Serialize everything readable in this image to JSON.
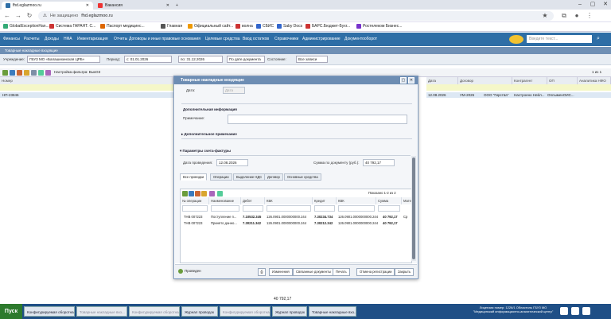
{
  "browser": {
    "tabs": [
      {
        "label": "fhd.eglazmoo.ru",
        "active": true
      },
      {
        "label": "Вакансия",
        "active": false
      }
    ],
    "url_security": "Не защищено",
    "url": "fhd.eglazmoo.ru",
    "bookmarks": [
      "GlobalExceptionHan...",
      "Система ГАРАНТ. С...",
      "Паспорт медицинс...",
      "Главная",
      "Официальный сайт...",
      "волна",
      "СБИС",
      "Saby Docs",
      "БАРС.Бюджет-Бухг...",
      "Ростелеком Бизнес..."
    ]
  },
  "app": {
    "menu": [
      "Финансы",
      "Расчеты",
      "Доходы",
      "НФА",
      "Инвентаризация",
      "Отчеты",
      "Договоры и иные правовые основания",
      "Целевые средства",
      "Ввод остатков",
      "Справочники",
      "Администрирование",
      "Документооборот"
    ],
    "search_placeholder": "Введите текст...",
    "doc_strip": "Товарные накладные входящие",
    "filter": {
      "institution_label": "Учреждение:",
      "institution_value": "ГБУЗ МО «Балашихинская ЦРБ»",
      "period_label": "Период:",
      "period_from": "с: 01.01.2026",
      "period_to": "по: 31.12.2026",
      "period_type": "По дате документа",
      "state_label": "Состояние:",
      "state_value": "Все записи"
    },
    "toolbar_filter_label": "Настройка фильтра: ВыкОЗ",
    "pager": "1 из 1",
    "grid_left_header": "Номер",
    "grid_left_row": "НП-23846",
    "grid_right_headers": [
      "Дата",
      "Договор",
      "Контрагент",
      "ОП",
      "Аналитика НФО"
    ],
    "grid_right_row": [
      "12.08.2026",
      "УМ-2026",
      "ООО \"Гирства\"",
      "Настроено Нейл...",
      "ОплыменОИС..."
    ]
  },
  "modal": {
    "title": "Товарные накладные входящие",
    "date_label": "Дата:",
    "date_value": "Дата",
    "additional_info_header": "Дополнительная информация",
    "note_label": "Примечание:",
    "extra_note_toggle": "Дополнительное примечание",
    "invoice_params_toggle": "Параметры счета-фактуры",
    "posting_date_label": "Дата проведения:",
    "posting_date_value": "12.08.2026",
    "doc_sum_label": "Сумма по документу (руб.):",
    "doc_sum_value": "40 792,17",
    "tabs": [
      "Все проводки",
      "Операции",
      "Выделение НДС",
      "Договор",
      "Основные средства"
    ],
    "shown": "Показано 1-2 из 2",
    "inner_headers": [
      "№ операции",
      "Наименование",
      "Дебет",
      "КБК",
      "Кредит",
      "КВК",
      "Сумма",
      "Материал"
    ],
    "inner_rows": [
      [
        "ТНВ 007223",
        "Поступление п...",
        "7.10532.345",
        "126.0901.0000000000.244",
        "7.30234.734",
        "126.0901.0000000000.244",
        "40 792,17",
        "Ср"
      ],
      [
        "ТНВ 007223",
        "Принято данно...",
        "7.30211.342",
        "126.0901.0000000000.244",
        "7.30212.342",
        "126.0901.0000000000.244",
        "40 792,17",
        ""
      ]
    ],
    "footer_left": "Проведен",
    "buttons": [
      "Изменения",
      "Связанные документы",
      "Печать",
      "Отмена регистрации",
      "Закрыть"
    ]
  },
  "summary_total": "40 792,17",
  "taskbar": {
    "start": "Пуск",
    "items": [
      {
        "label": "Конфигурируемая оборотная...",
        "dim": false
      },
      {
        "label": "Товарные накладные вхо...",
        "dim": true
      },
      {
        "label": "Конфигурируемая оборотная...",
        "dim": true
      },
      {
        "label": "Журнал проводок",
        "dim": false
      },
      {
        "label": "Конфигурируемая оборотная...",
        "dim": true
      },
      {
        "label": "Журнал проводок",
        "dim": false
      },
      {
        "label": "Товарные накладные вхо...",
        "dim": false
      }
    ],
    "info": "Лицензия номер: 1226/1 Областиль ГБУЗ МО \"Медицинский информационно-аналитический центр\""
  }
}
